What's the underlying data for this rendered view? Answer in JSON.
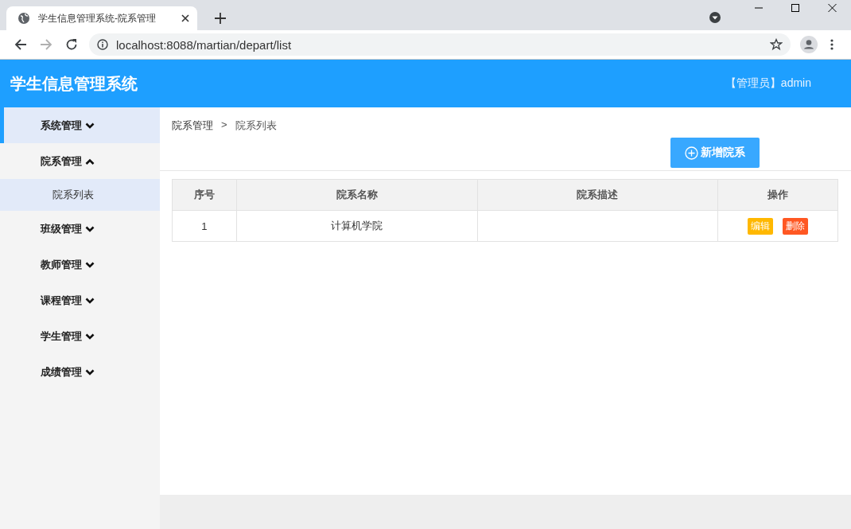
{
  "browser": {
    "tab_title": "学生信息管理系统-院系管理",
    "address": "localhost:8088/martian/depart/list"
  },
  "header": {
    "title": "学生信息管理系统",
    "user": "【管理员】admin"
  },
  "sidebar": {
    "items": [
      {
        "label": "系统管理",
        "selected": true,
        "expanded": false
      },
      {
        "label": "院系管理",
        "selected": false,
        "expanded": true,
        "children": [
          {
            "label": "院系列表",
            "selected": true
          }
        ]
      },
      {
        "label": "班级管理",
        "selected": false,
        "expanded": false
      },
      {
        "label": "教师管理",
        "selected": false,
        "expanded": false
      },
      {
        "label": "课程管理",
        "selected": false,
        "expanded": false
      },
      {
        "label": "学生管理",
        "selected": false,
        "expanded": false
      },
      {
        "label": "成绩管理",
        "selected": false,
        "expanded": false
      }
    ]
  },
  "breadcrumb": {
    "items": [
      "院系管理",
      "院系列表"
    ],
    "separator": ">"
  },
  "add_button": {
    "label": "新增院系"
  },
  "table": {
    "columns": [
      "序号",
      "院系名称",
      "院系描述",
      "操作"
    ],
    "rows": [
      {
        "number": "1",
        "name": "计算机学院",
        "actions": [
          {
            "kind": "edit",
            "label": "编辑"
          },
          {
            "kind": "delete",
            "label": "删除"
          }
        ]
      }
    ]
  }
}
